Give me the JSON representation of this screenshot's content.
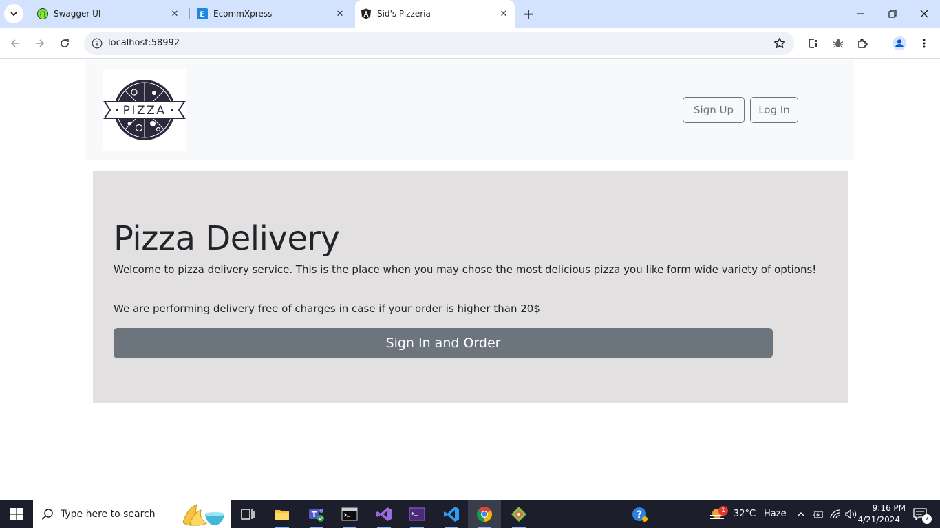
{
  "browser": {
    "tabs": [
      {
        "title": "Swagger UI",
        "active": false,
        "favicon": "swagger-icon"
      },
      {
        "title": "EcommXpress",
        "active": false,
        "favicon": "ecommxpress-icon"
      },
      {
        "title": "Sid's Pizzeria",
        "active": true,
        "favicon": "angular-icon"
      }
    ],
    "address": "localhost:58992"
  },
  "site": {
    "logo_text": "PIZZA",
    "nav": {
      "signup_label": "Sign Up",
      "login_label": "Log In"
    }
  },
  "hero": {
    "title": "Pizza Delivery",
    "lead": "Welcome to pizza delivery service. This is the place when you may chose the most delicious pizza you like form wide variety of options!",
    "note": "We are performing delivery free of charges in case if your order is higher than 20$",
    "cta_label": "Sign In and Order"
  },
  "taskbar": {
    "search_placeholder": "Type here to search",
    "weather": {
      "temp": "32°C",
      "condition": "Haze",
      "badge": "1"
    },
    "time": "9:16 PM",
    "date": "4/21/2024",
    "notification_count": "7"
  },
  "colors": {
    "tabbar": "#d3e3fd",
    "header_bg": "#f8f9fa",
    "jumbotron_bg": "#e2e0e1",
    "button_secondary": "#6c757d",
    "taskbar": "#1c1f2b"
  }
}
